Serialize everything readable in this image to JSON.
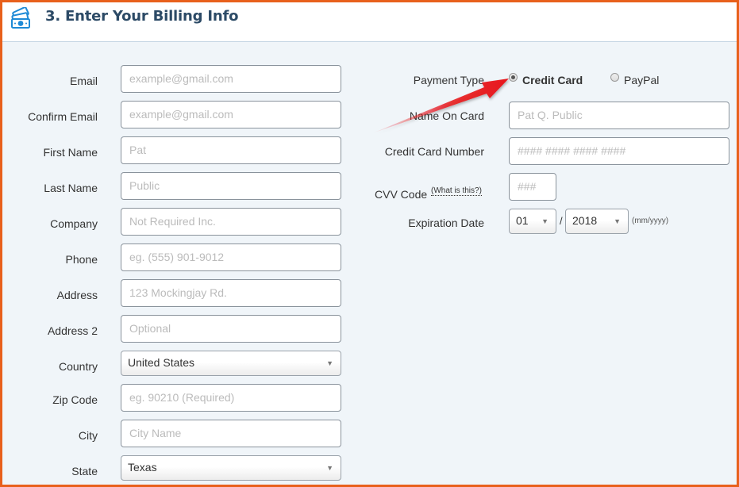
{
  "header": {
    "title": "3. Enter Your Billing Info",
    "icon": "money-icon"
  },
  "left_fields": [
    {
      "label": "Email",
      "type": "input",
      "placeholder": "example@gmail.com"
    },
    {
      "label": "Confirm Email",
      "type": "input",
      "placeholder": "example@gmail.com"
    },
    {
      "label": "First Name",
      "type": "input",
      "placeholder": "Pat"
    },
    {
      "label": "Last Name",
      "type": "input",
      "placeholder": "Public"
    },
    {
      "label": "Company",
      "type": "input",
      "placeholder": "Not Required Inc."
    },
    {
      "label": "Phone",
      "type": "input",
      "placeholder": "eg. (555) 901-9012"
    },
    {
      "label": "Address",
      "type": "input",
      "placeholder": "123 Mockingjay Rd."
    },
    {
      "label": "Address 2",
      "type": "input",
      "placeholder": "Optional"
    },
    {
      "label": "Country",
      "type": "select",
      "value": "United States"
    },
    {
      "label": "Zip Code",
      "type": "input",
      "placeholder": "eg. 90210 (Required)"
    },
    {
      "label": "City",
      "type": "input",
      "placeholder": "City Name"
    },
    {
      "label": "State",
      "type": "select",
      "value": "Texas"
    }
  ],
  "payment": {
    "label": "Payment Type",
    "options": [
      {
        "label": "Credit Card",
        "selected": true
      },
      {
        "label": "PayPal",
        "selected": false
      }
    ]
  },
  "name_on_card": {
    "label": "Name On Card",
    "placeholder": "Pat Q. Public"
  },
  "card_number": {
    "label": "Credit Card Number",
    "placeholder": "#### #### #### ####"
  },
  "cvv": {
    "label": "CVV Code",
    "help_link": "(What is this?)",
    "placeholder": "###"
  },
  "expiration": {
    "label": "Expiration Date",
    "month": "01",
    "separator": "/",
    "year": "2018",
    "hint": "(mm/yyyy)"
  },
  "annotation": {
    "arrow_color": "#e8141a",
    "points_to": "Credit Card"
  },
  "colors": {
    "frame": "#e8601c",
    "title": "#2c4a66",
    "background": "#f0f5f9"
  }
}
